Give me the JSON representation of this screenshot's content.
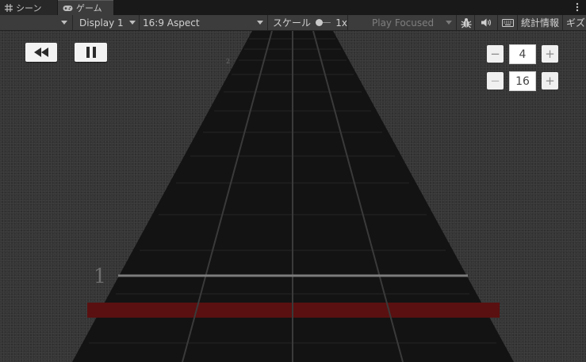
{
  "tabs": [
    {
      "label": "シーン",
      "icon": "grid-icon",
      "active": false
    },
    {
      "label": "ゲーム",
      "icon": "gamepad-icon",
      "active": true
    }
  ],
  "toolbar": {
    "display": "Display 1",
    "aspect": "16:9 Aspect",
    "scale_label": "スケール",
    "scale_value": "1x",
    "play_mode": "Play Focused",
    "stats": "統計情報",
    "gizmos": "ギズモ"
  },
  "controls": {
    "rewind_icon": "rewind-icon",
    "pause_icon": "pause-icon",
    "top_stepper": {
      "minus": "−",
      "value": "4",
      "plus": "+"
    },
    "bottom_stepper": {
      "minus": "−",
      "value": "16",
      "plus": "+"
    }
  },
  "lanes": {
    "near_label": "1",
    "far_label": "2"
  },
  "colors": {
    "road": "#131313",
    "judgement_bar": "#5a1010",
    "viewport_bg": "#363636"
  }
}
